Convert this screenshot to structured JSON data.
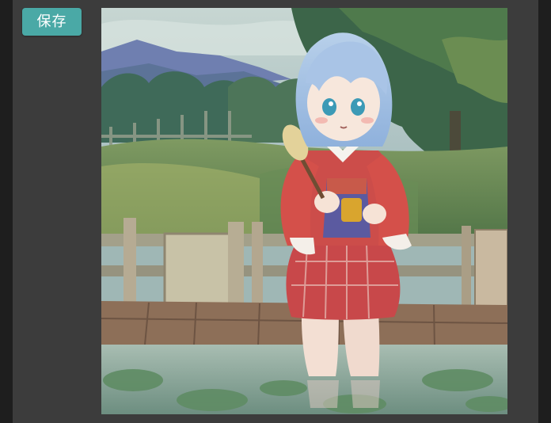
{
  "toolbar": {
    "save_label": "保存"
  },
  "image": {
    "alt": "",
    "subject_icon": "artwork-image"
  },
  "colors": {
    "page_background": "#1e1e1e",
    "panel_background": "#3c3c3c",
    "button_background": "#4aa9a6",
    "button_text": "#ffffff"
  }
}
